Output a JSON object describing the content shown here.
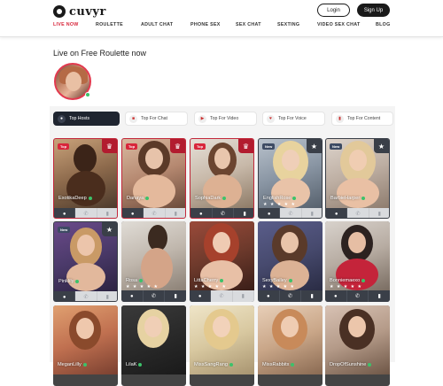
{
  "header": {
    "logo_text": "cuvyr",
    "login_label": "Login",
    "signup_label": "Sign Up"
  },
  "nav": {
    "items": [
      {
        "label": "LIVE NOW",
        "active": true
      },
      {
        "label": "ROULETTE",
        "active": false
      },
      {
        "label": "ADULT CHAT",
        "active": false
      },
      {
        "label": "PHONE SEX",
        "active": false
      },
      {
        "label": "SEX CHAT",
        "active": false
      },
      {
        "label": "SEXTING",
        "active": false
      },
      {
        "label": "VIDEO SEX CHAT",
        "active": false
      },
      {
        "label": "BLOG",
        "active": false
      }
    ]
  },
  "roulette": {
    "title": "Live on Free Roulette now"
  },
  "tabs": [
    {
      "label": "Top Hosts",
      "icon": "user-icon",
      "active": true
    },
    {
      "label": "Top For Chat",
      "icon": "chat-icon",
      "active": false
    },
    {
      "label": "Top For Video",
      "icon": "video-icon",
      "active": false
    },
    {
      "label": "Top For Voice",
      "icon": "mic-icon",
      "active": false
    },
    {
      "label": "Top For Content",
      "icon": "content-icon",
      "active": false
    }
  ],
  "hosts": [
    {
      "name": "ExotikaDeep",
      "badge": "Top",
      "corner": "crown",
      "stars": "",
      "actions": [
        "chat",
        "phone-off",
        "video-off"
      ]
    },
    {
      "name": "Danaya",
      "badge": "Top",
      "corner": "crown",
      "stars": "",
      "actions": [
        "chat",
        "phone-off",
        "video-off"
      ]
    },
    {
      "name": "SophiaDark",
      "badge": "Top",
      "corner": "crown",
      "stars": "",
      "actions": [
        "chat",
        "phone",
        "video"
      ]
    },
    {
      "name": "EnglishRose",
      "badge": "New",
      "corner": "star",
      "stars": "★ ★ ★ ★ ★",
      "actions": [
        "chat",
        "phone-off",
        "video-off"
      ]
    },
    {
      "name": "BarbieHarper",
      "badge": "New",
      "corner": "star",
      "stars": "",
      "actions": [
        "chat",
        "phone-off",
        "video-off"
      ]
    },
    {
      "name": "Pinklily",
      "badge": "New",
      "corner": "star",
      "stars": "",
      "actions": [
        "chat",
        "phone-off",
        "video-off"
      ]
    },
    {
      "name": "Rosa",
      "badge": "",
      "corner": "",
      "stars": "★ ★ ★ ★ ★",
      "actions": [
        "chat",
        "phone",
        "video"
      ]
    },
    {
      "name": "LittaCherry",
      "badge": "",
      "corner": "",
      "stars": "★ ★ ★ ★ ★",
      "actions": [
        "chat",
        "phone-off",
        "video-off"
      ]
    },
    {
      "name": "SexyBailey",
      "badge": "",
      "corner": "",
      "stars": "★ ★ ★ ★ ★",
      "actions": [
        "chat",
        "phone",
        "video"
      ]
    },
    {
      "name": "Bonniemaexo",
      "badge": "",
      "corner": "",
      "stars": "★ ★ ★ ★ ★",
      "actions": [
        "chat",
        "phone",
        "video"
      ]
    },
    {
      "name": "MeganLilly",
      "badge": "",
      "corner": "",
      "stars": "",
      "actions": []
    },
    {
      "name": "LilaK",
      "badge": "",
      "corner": "",
      "stars": "",
      "actions": []
    },
    {
      "name": "MissSangRang",
      "badge": "",
      "corner": "",
      "stars": "",
      "actions": []
    },
    {
      "name": "MissRabbitx",
      "badge": "",
      "corner": "",
      "stars": "",
      "actions": []
    },
    {
      "name": "DropOfSunshine",
      "badge": "",
      "corner": "",
      "stars": "",
      "actions": []
    }
  ],
  "colors": {
    "accent": "#d8263b",
    "dark": "#1a1a1a",
    "online": "#3cc26a"
  }
}
